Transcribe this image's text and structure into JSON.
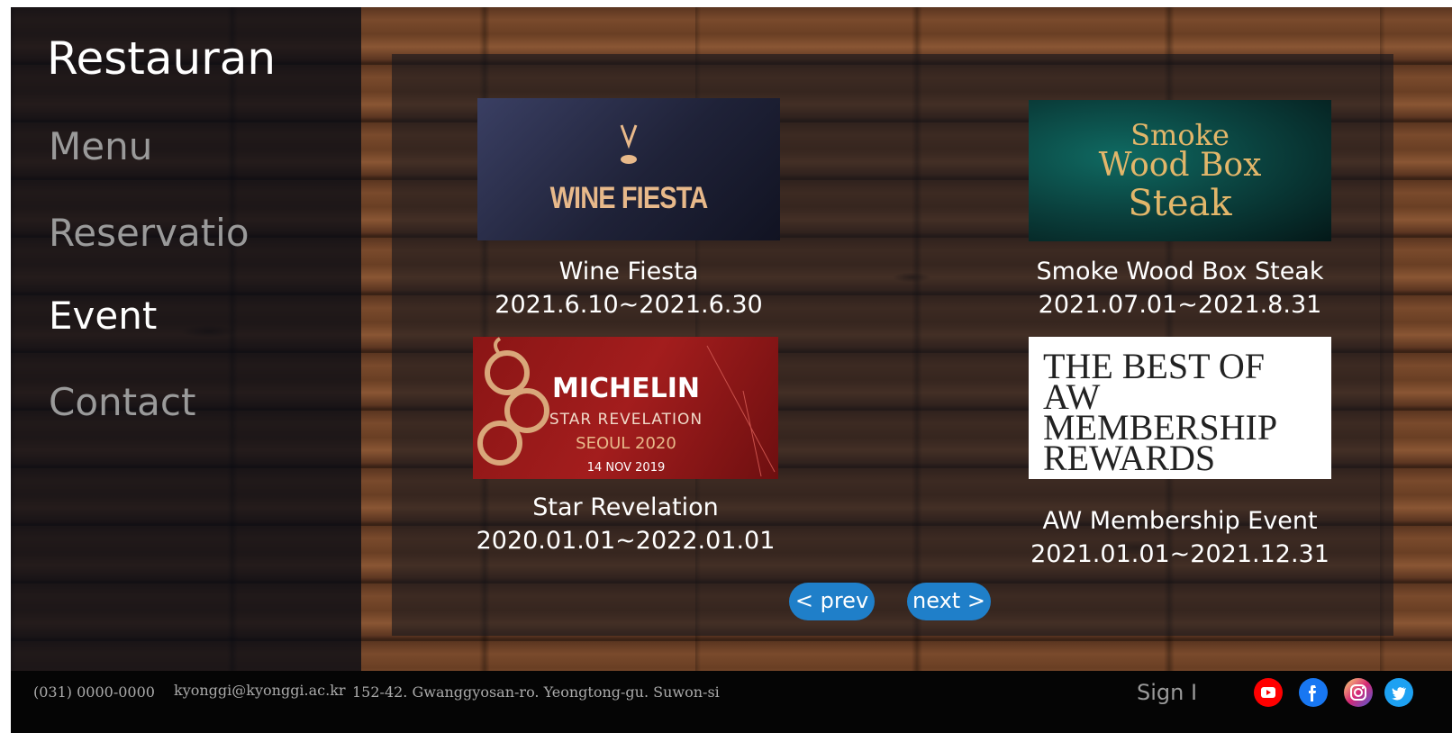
{
  "brand": "Restauran",
  "nav": [
    "Menu",
    "Reservatio",
    "Event",
    "Contact"
  ],
  "events": [
    {
      "banner": "WINE FIESTA",
      "title": "Wine Fiesta",
      "date": "2021.6.10~2021.6.30"
    },
    {
      "banner_lines": [
        "Smoke",
        "Wood Box",
        "Steak"
      ],
      "title": "Smoke Wood Box Steak",
      "date": "2021.07.01~2021.8.31"
    },
    {
      "banner_lines": [
        "MICHELIN",
        "STAR REVELATION",
        "SEOUL 2020",
        "14 NOV 2019"
      ],
      "title": "Star Revelation",
      "date": "2020.01.01~2022.01.01"
    },
    {
      "banner_lines": [
        "THE BEST OF",
        "AW",
        "MEMBERSHIP",
        "REWARDS"
      ],
      "title": "AW Membership Event",
      "date": "2021.01.01~2021.12.31"
    }
  ],
  "pager": {
    "prev": "< prev",
    "next": "next >"
  },
  "footer": {
    "phone": "(031) 0000-0000",
    "email": "kyonggi@kyonggi.ac.kr",
    "address": "152-42. Gwanggyosan-ro. Yeongtong-gu. Suwon-si",
    "sign": "Sign I"
  },
  "social": [
    {
      "icon": "youtube-icon",
      "color": "#ff0000"
    },
    {
      "icon": "facebook-icon",
      "color": "#1877f2"
    },
    {
      "icon": "instagram-icon",
      "color": "#e1306c"
    },
    {
      "icon": "twitter-icon",
      "color": "#1da1f2"
    }
  ]
}
